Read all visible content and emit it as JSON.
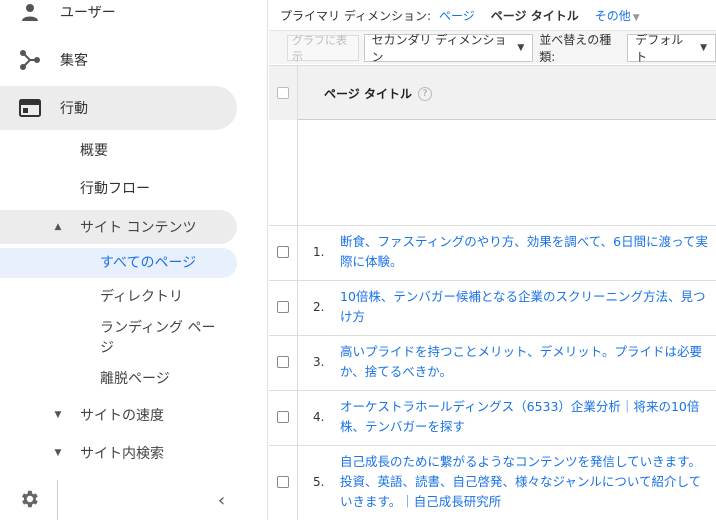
{
  "sidebar": {
    "users_label": "ユーザー",
    "acquisition_label": "集客",
    "behavior_label": "行動",
    "overview_label": "概要",
    "flow_label": "行動フロー",
    "site_content_label": "サイト コンテンツ",
    "site_content_items": [
      "すべてのページ",
      "ディレクトリ",
      "ランディング ページ",
      "離脱ページ"
    ],
    "site_speed_label": "サイトの速度",
    "site_search_label": "サイト内検索"
  },
  "dimension_bar": {
    "label": "プライマリ ディメンション:",
    "page_link": "ページ",
    "current": "ページ タイトル",
    "more": "その他"
  },
  "toolbar": {
    "graph_button": "グラフに表示",
    "secondary_dimension": "セカンダリ ディメンション",
    "sort_label": "並べ替えの種類:",
    "sort_value": "デフォルト"
  },
  "table": {
    "header_title": "ページ タイトル",
    "help": "?",
    "rows": [
      {
        "num": "1.",
        "text": "断食、ファスティングのやり方、効果を調べて、6日間に渡って実際に体験。"
      },
      {
        "num": "2.",
        "text": "10倍株、テンバガー候補となる企業のスクリーニング方法、見つけ方"
      },
      {
        "num": "3.",
        "text": "高いプライドを持つことメリット、デメリット。プライドは必要か、捨てるべきか。"
      },
      {
        "num": "4.",
        "text": "オーケストラホールディングス（6533）企業分析｜将来の10倍株、テンバガーを探す"
      },
      {
        "num": "5.",
        "text": "自己成長のために繋がるようなコンテンツを発信していきます。投資、英語、読書、自己啓発、様々なジャンルについて紹介していきます。｜自己成長研究所"
      }
    ]
  },
  "colors": {
    "link": "#1a73e8",
    "active_bg": "#ececec",
    "selected_bg": "#e8f0fe"
  }
}
